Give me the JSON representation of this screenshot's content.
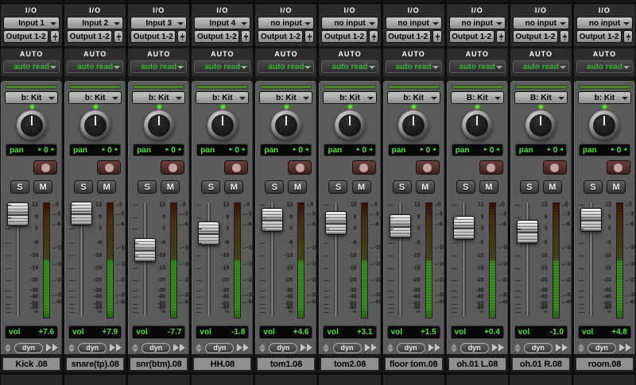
{
  "window": {
    "app": "Pro Tools Mix Window"
  },
  "labels": {
    "io_header": "I/O",
    "auto_header": "AUTO",
    "pan": "pan",
    "vol": "vol",
    "dyn": "dyn",
    "solo": "S",
    "mute": "M",
    "pan_arrow_right": "▸",
    "pan_arrow_left": "◂"
  },
  "colors": {
    "lcd_green": "#4ee13e",
    "auto_green": "#3fae3f",
    "group_bar_green": "#4d7c2f",
    "meter_lit_green": "#3f9d22",
    "record_maroon": "#5a3431",
    "panel_gray": "#5a5a5a",
    "section_dark": "#2c2c2c"
  },
  "fader_scale": [
    "12",
    "6",
    "0",
    "-5",
    "-10",
    "-15",
    "-20",
    "-30",
    "-40",
    "-60",
    "-90",
    "∞"
  ],
  "meter_scale": [
    "0",
    "-3",
    "-6",
    "-10",
    "-16",
    "-22",
    "-32",
    "-60"
  ],
  "strips": [
    {
      "input": "Input 1",
      "output": "Output 1-2",
      "auto_mode": "auto read",
      "group": "b: Kit",
      "pan": "0",
      "vol": "+7.6",
      "vol_db": 7.6,
      "name": "Kick .08"
    },
    {
      "input": "Input 2",
      "output": "Output 1-2",
      "auto_mode": "auto read",
      "group": "b: Kit",
      "pan": "0",
      "vol": "+7.9",
      "vol_db": 7.9,
      "name": "snare(tp).08"
    },
    {
      "input": "Input 3",
      "output": "Output 1-2",
      "auto_mode": "auto read",
      "group": "b: Kit",
      "pan": "0",
      "vol": "-7.7",
      "vol_db": -7.7,
      "name": "snr(btm).08"
    },
    {
      "input": "Input 4",
      "output": "Output 1-2",
      "auto_mode": "auto read",
      "group": "b: Kit",
      "pan": "0",
      "vol": "-1.8",
      "vol_db": -1.8,
      "name": "HH.08"
    },
    {
      "input": "no input",
      "output": "Output 1-2",
      "auto_mode": "auto read",
      "group": "b: Kit",
      "pan": "0",
      "vol": "+4.6",
      "vol_db": 4.6,
      "name": "tom1.08"
    },
    {
      "input": "no input",
      "output": "Output 1-2",
      "auto_mode": "auto read",
      "group": "b: Kit",
      "pan": "0",
      "vol": "+3.1",
      "vol_db": 3.1,
      "name": "tom2.08"
    },
    {
      "input": "no input",
      "output": "Output 1-2",
      "auto_mode": "auto read",
      "group": "b: Kit",
      "pan": "0",
      "vol": "+1.5",
      "vol_db": 1.5,
      "name": "floor tom.08"
    },
    {
      "input": "no input",
      "output": "Output 1-2",
      "auto_mode": "auto read",
      "group": "B: Kit",
      "pan": "0",
      "vol": "+0.4",
      "vol_db": 0.4,
      "name": "oh.01 L.08"
    },
    {
      "input": "no input",
      "output": "Output 1-2",
      "auto_mode": "auto read",
      "group": "B: Kit",
      "pan": "0",
      "vol": "-1.0",
      "vol_db": -1.0,
      "name": "oh.01 R.08"
    },
    {
      "input": "no input",
      "output": "Output 1-2",
      "auto_mode": "auto read",
      "group": "b: Kit",
      "pan": "0",
      "vol": "+4.8",
      "vol_db": 4.8,
      "name": "room.08"
    }
  ]
}
